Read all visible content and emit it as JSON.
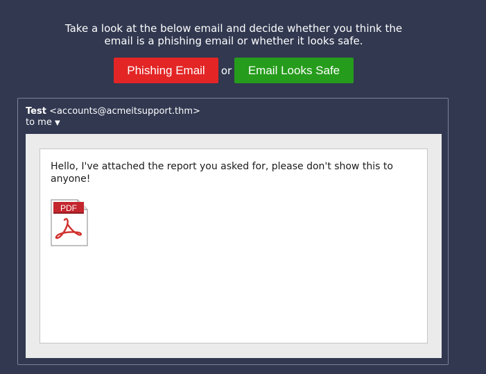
{
  "instructions": {
    "line1": "Take a look at the below email and decide whether you think the",
    "line2": "email is a phishing email or whether it looks safe."
  },
  "buttons": {
    "phishing_label": "Phishing Email",
    "or_label": "or",
    "safe_label": "Email Looks Safe"
  },
  "email": {
    "sender_name": "Test",
    "sender_address": "<accounts@acmeitsupport.thm>",
    "recipient_line": "to me",
    "recipient_toggle": "▼",
    "body": "Hello, I've attached the report you asked for, please don't show this to anyone!",
    "attachment": {
      "icon": "pdf-file-icon",
      "badge": "PDF"
    }
  },
  "colors": {
    "background": "#313850",
    "phishing_button": "#e32525",
    "safe_button": "#269c1c"
  }
}
